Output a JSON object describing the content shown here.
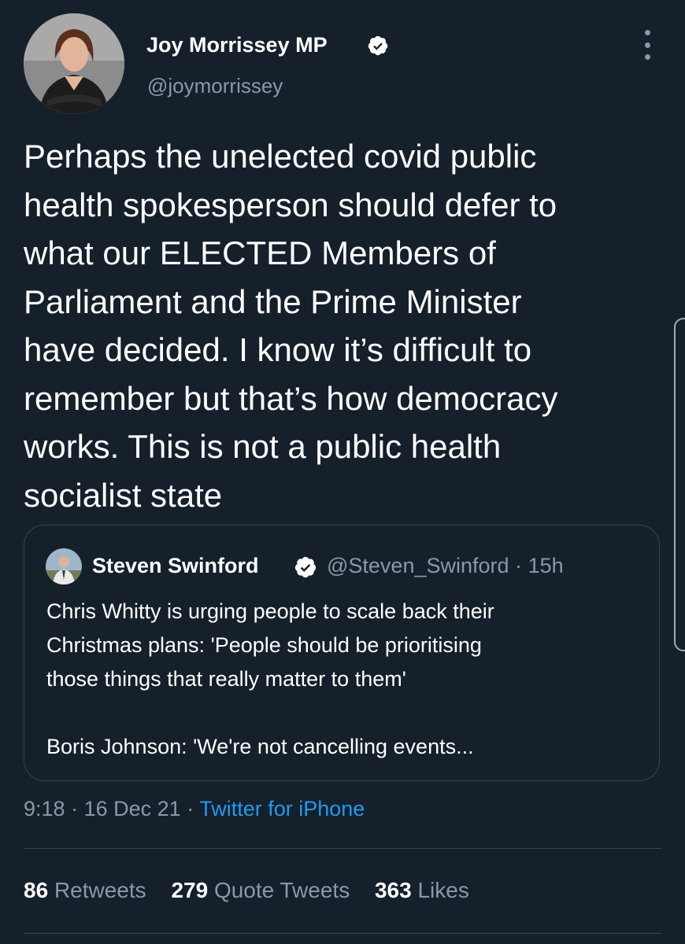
{
  "author": {
    "name": "Joy Morrissey MP",
    "handle": "@joymorrissey",
    "verified_icon": "verified-badge-icon",
    "more_icon": "more-vertical-icon"
  },
  "tweet": {
    "text_lines": [
      "Perhaps the unelected covid public",
      "health spokesperson should defer to",
      "what our ELECTED Members of",
      "Parliament and the Prime Minister",
      "have decided. I know it’s difficult to",
      "remember but that’s how democracy",
      "works. This is not a public health",
      "socialist state"
    ]
  },
  "quote": {
    "name": "Steven Swinford",
    "handle": "@Steven_Swinford",
    "separator": "·",
    "time": "15h",
    "text_lines": [
      "Chris Whitty is urging people to scale back their",
      "Christmas plans: 'People should be prioritising",
      "those things that really matter to them'",
      "",
      "Boris Johnson: 'We're not cancelling events..."
    ]
  },
  "meta": {
    "time": "9:18",
    "separator": "·",
    "date": "16 Dec 21",
    "source": "Twitter for iPhone"
  },
  "stats": {
    "retweets_count": "86",
    "retweets_label": "Retweets",
    "quotes_count": "279",
    "quotes_label": "Quote Tweets",
    "likes_count": "363",
    "likes_label": "Likes"
  },
  "colors": {
    "background": "#15202b",
    "text_primary": "#ffffff",
    "text_secondary": "#8b98a5",
    "accent_link": "#1d9bf0",
    "border": "#38444d"
  }
}
